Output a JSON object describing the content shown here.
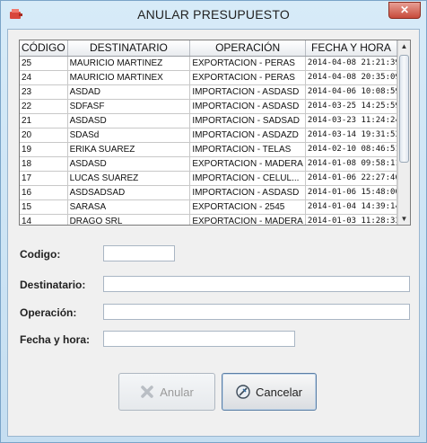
{
  "window": {
    "title": "ANULAR PRESUPUESTO",
    "close_label": "✕"
  },
  "table": {
    "columns": [
      "CÓDIGO",
      "DESTINATARIO",
      "OPERACIÓN",
      "FECHA Y HORA"
    ],
    "rows": [
      [
        "25",
        "MAURICIO MARTINEZ",
        "EXPORTACION - PERAS",
        "2014-04-08 21:21:39.0"
      ],
      [
        "24",
        "MAURICIO MARTINEX",
        "EXPORTACION - PERAS",
        "2014-04-08 20:35:09.0"
      ],
      [
        "23",
        "ASDAD",
        "IMPORTACION - ASDASD",
        "2014-04-06 10:08:59.0"
      ],
      [
        "22",
        "SDFASF",
        "IMPORTACION - ASDASD",
        "2014-03-25 14:25:59.0"
      ],
      [
        "21",
        "ASDASD",
        "IMPORTACION - SADSAD",
        "2014-03-23 11:24:24.0"
      ],
      [
        "20",
        "SDASd",
        "IMPORTACION - ASDAZD",
        "2014-03-14 19:31:53.0"
      ],
      [
        "19",
        "ERIKA SUAREZ",
        "IMPORTACION - TELAS",
        "2014-02-10 08:46:51.0"
      ],
      [
        "18",
        "ASDASD",
        "EXPORTACION - MADERA",
        "2014-01-08 09:58:11.0"
      ],
      [
        "17",
        "LUCAS SUAREZ",
        "IMPORTACION - CELUL...",
        "2014-01-06 22:27:46.0"
      ],
      [
        "16",
        "ASDSADSAD",
        "IMPORTACION - ASDASD",
        "2014-01-06 15:48:00.0"
      ],
      [
        "15",
        "SARASA",
        "EXPORTACION - 2545",
        "2014-01-04 14:39:14.0"
      ],
      [
        "14",
        "DRAGO SRL",
        "EXPORTACION - MADERA",
        "2014-01-03 11:28:33.0"
      ]
    ]
  },
  "form": {
    "codigo_label": "Codigo:",
    "destinatario_label": "Destinatario:",
    "operacion_label": "Operación:",
    "fecha_label": "Fecha y hora:",
    "codigo_value": "",
    "destinatario_value": "",
    "operacion_value": "",
    "fecha_value": ""
  },
  "buttons": {
    "anular_label": "Anular",
    "cancelar_label": "Cancelar"
  },
  "colors": {
    "accent": "#2f6fa8",
    "titlebar_bg": "#cfe4f3",
    "close": "#c74a3b"
  }
}
